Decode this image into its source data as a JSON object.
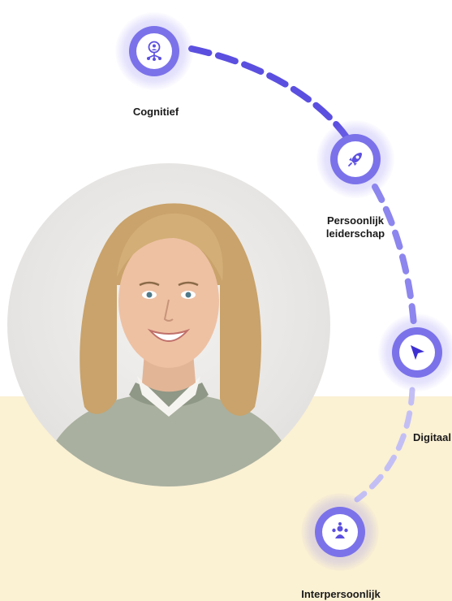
{
  "nodes": {
    "cognitief": {
      "label": "Cognitief",
      "icon": "network-person-icon"
    },
    "persoonlijk": {
      "label_line1": "Persoonlijk",
      "label_line2": "leiderschap",
      "icon": "rocket-icon"
    },
    "digitaal": {
      "label": "Digitaal",
      "icon": "cursor-arrow-icon"
    },
    "interpersoonlijk": {
      "label": "Interpersoonlijk",
      "icon": "group-icon"
    }
  },
  "colors": {
    "accent": "#5b4fe0",
    "halo": "#7b72ea",
    "band": "#fbf1d3",
    "text": "#1a1a1a"
  }
}
